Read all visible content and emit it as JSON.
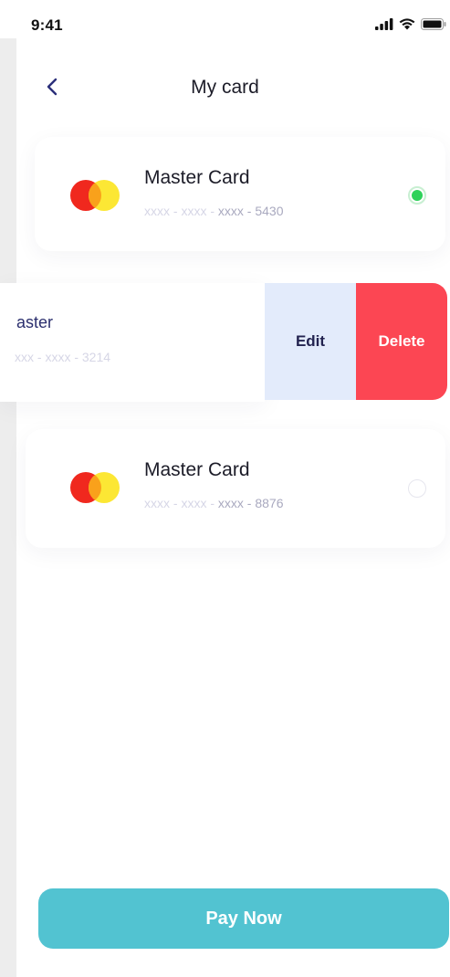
{
  "status_bar": {
    "time": "9:41",
    "icons": [
      "signal-icon",
      "wifi-icon",
      "battery-icon"
    ]
  },
  "header": {
    "back_icon": "chevron-left-icon",
    "title": "My card"
  },
  "cards": [
    {
      "title": "Master Card",
      "number_masked": "xxxx - xxxx - ",
      "number_last": "xxxx - 5430",
      "selected": true
    },
    {
      "title": "aster",
      "number_masked": "xxx - xxxx - 3214",
      "number_last": "",
      "selected": false
    },
    {
      "title": "Master Card",
      "number_masked": "xxxx - xxxx - ",
      "number_last": "xxxx - 8876",
      "selected": false
    }
  ],
  "swipe_actions": {
    "edit_label": "Edit",
    "delete_label": "Delete"
  },
  "pay_button": {
    "label": "Pay Now"
  },
  "colors": {
    "accent": "#52c3d1",
    "delete": "#fc4653",
    "edit_bg": "#e3ebfb",
    "selected_radio": "#2ed25a",
    "mastercard_red": "#f0281e",
    "mastercard_yellow": "#fce629"
  }
}
